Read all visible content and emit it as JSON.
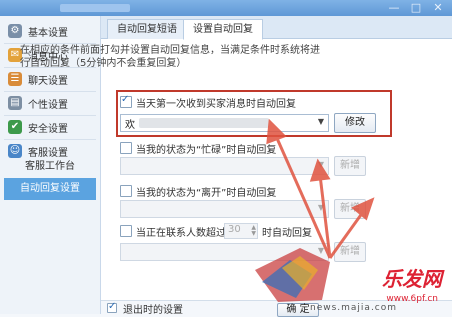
{
  "window": {
    "minimize": "—",
    "restore": "□",
    "close": "✕"
  },
  "sidebar": {
    "items": [
      {
        "label": "基本设置",
        "icon": "gear-icon",
        "glyph": "⚙",
        "color": "#7a8fa8"
      },
      {
        "label": "消息中心",
        "icon": "mail-icon",
        "glyph": "✉",
        "color": "#e3a23b"
      },
      {
        "label": "聊天设置",
        "icon": "chat-icon",
        "glyph": "☰",
        "color": "#d98c3a"
      },
      {
        "label": "个性设置",
        "icon": "profile-icon",
        "glyph": "▤",
        "color": "#7d8fa3"
      },
      {
        "label": "安全设置",
        "icon": "shield-icon",
        "glyph": "✔",
        "color": "#3d9a4b"
      },
      {
        "label": "客服设置",
        "icon": "headset-icon",
        "glyph": "☺",
        "color": "#4a86c8"
      }
    ],
    "subitems": [
      {
        "label": "客服工作台"
      },
      {
        "label": "自动回复设置"
      }
    ]
  },
  "tabs": [
    {
      "label": "自动回复短语"
    },
    {
      "label": "设置自动回复"
    }
  ],
  "description": "在相应的条件前面打勾并设置自动回复信息，当满足条件时系统将进行自动回复（5分钟内不会重复回复）",
  "options": {
    "first_msg": {
      "label": "当天第一次收到买家消息时自动回复",
      "checked": true,
      "value": "欢",
      "button": "修改"
    },
    "busy": {
      "label": "当我的状态为“忙碌”时自动回复",
      "checked": false,
      "button": "新增"
    },
    "away": {
      "label": "当我的状态为“离开”时自动回复",
      "checked": false,
      "button": "新增"
    },
    "contacts": {
      "label_before": "当正在联系人数超过",
      "number": "30",
      "label_after": "时自动回复",
      "checked": false,
      "button": "新增"
    }
  },
  "bottom": {
    "label": "退出时的设置",
    "button": "确 定"
  },
  "watermark": {
    "brand": "乐发网",
    "url": "www.6pf.cn",
    "url2": "news.majia.com"
  }
}
